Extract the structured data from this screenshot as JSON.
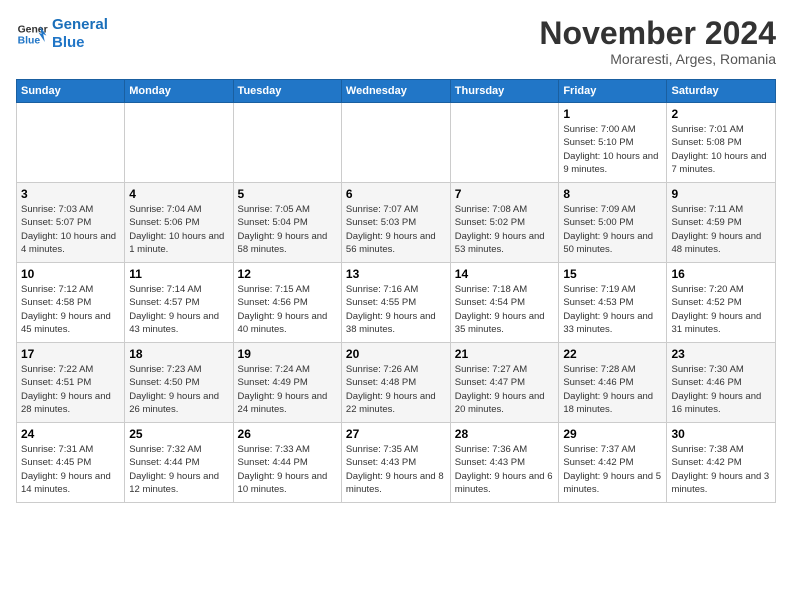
{
  "header": {
    "logo_line1": "General",
    "logo_line2": "Blue",
    "month_title": "November 2024",
    "subtitle": "Moraresti, Arges, Romania"
  },
  "days_of_week": [
    "Sunday",
    "Monday",
    "Tuesday",
    "Wednesday",
    "Thursday",
    "Friday",
    "Saturday"
  ],
  "weeks": [
    [
      {
        "day": "",
        "info": ""
      },
      {
        "day": "",
        "info": ""
      },
      {
        "day": "",
        "info": ""
      },
      {
        "day": "",
        "info": ""
      },
      {
        "day": "",
        "info": ""
      },
      {
        "day": "1",
        "info": "Sunrise: 7:00 AM\nSunset: 5:10 PM\nDaylight: 10 hours\nand 9 minutes."
      },
      {
        "day": "2",
        "info": "Sunrise: 7:01 AM\nSunset: 5:08 PM\nDaylight: 10 hours\nand 7 minutes."
      }
    ],
    [
      {
        "day": "3",
        "info": "Sunrise: 7:03 AM\nSunset: 5:07 PM\nDaylight: 10 hours\nand 4 minutes."
      },
      {
        "day": "4",
        "info": "Sunrise: 7:04 AM\nSunset: 5:06 PM\nDaylight: 10 hours\nand 1 minute."
      },
      {
        "day": "5",
        "info": "Sunrise: 7:05 AM\nSunset: 5:04 PM\nDaylight: 9 hours\nand 58 minutes."
      },
      {
        "day": "6",
        "info": "Sunrise: 7:07 AM\nSunset: 5:03 PM\nDaylight: 9 hours\nand 56 minutes."
      },
      {
        "day": "7",
        "info": "Sunrise: 7:08 AM\nSunset: 5:02 PM\nDaylight: 9 hours\nand 53 minutes."
      },
      {
        "day": "8",
        "info": "Sunrise: 7:09 AM\nSunset: 5:00 PM\nDaylight: 9 hours\nand 50 minutes."
      },
      {
        "day": "9",
        "info": "Sunrise: 7:11 AM\nSunset: 4:59 PM\nDaylight: 9 hours\nand 48 minutes."
      }
    ],
    [
      {
        "day": "10",
        "info": "Sunrise: 7:12 AM\nSunset: 4:58 PM\nDaylight: 9 hours\nand 45 minutes."
      },
      {
        "day": "11",
        "info": "Sunrise: 7:14 AM\nSunset: 4:57 PM\nDaylight: 9 hours\nand 43 minutes."
      },
      {
        "day": "12",
        "info": "Sunrise: 7:15 AM\nSunset: 4:56 PM\nDaylight: 9 hours\nand 40 minutes."
      },
      {
        "day": "13",
        "info": "Sunrise: 7:16 AM\nSunset: 4:55 PM\nDaylight: 9 hours\nand 38 minutes."
      },
      {
        "day": "14",
        "info": "Sunrise: 7:18 AM\nSunset: 4:54 PM\nDaylight: 9 hours\nand 35 minutes."
      },
      {
        "day": "15",
        "info": "Sunrise: 7:19 AM\nSunset: 4:53 PM\nDaylight: 9 hours\nand 33 minutes."
      },
      {
        "day": "16",
        "info": "Sunrise: 7:20 AM\nSunset: 4:52 PM\nDaylight: 9 hours\nand 31 minutes."
      }
    ],
    [
      {
        "day": "17",
        "info": "Sunrise: 7:22 AM\nSunset: 4:51 PM\nDaylight: 9 hours\nand 28 minutes."
      },
      {
        "day": "18",
        "info": "Sunrise: 7:23 AM\nSunset: 4:50 PM\nDaylight: 9 hours\nand 26 minutes."
      },
      {
        "day": "19",
        "info": "Sunrise: 7:24 AM\nSunset: 4:49 PM\nDaylight: 9 hours\nand 24 minutes."
      },
      {
        "day": "20",
        "info": "Sunrise: 7:26 AM\nSunset: 4:48 PM\nDaylight: 9 hours\nand 22 minutes."
      },
      {
        "day": "21",
        "info": "Sunrise: 7:27 AM\nSunset: 4:47 PM\nDaylight: 9 hours\nand 20 minutes."
      },
      {
        "day": "22",
        "info": "Sunrise: 7:28 AM\nSunset: 4:46 PM\nDaylight: 9 hours\nand 18 minutes."
      },
      {
        "day": "23",
        "info": "Sunrise: 7:30 AM\nSunset: 4:46 PM\nDaylight: 9 hours\nand 16 minutes."
      }
    ],
    [
      {
        "day": "24",
        "info": "Sunrise: 7:31 AM\nSunset: 4:45 PM\nDaylight: 9 hours\nand 14 minutes."
      },
      {
        "day": "25",
        "info": "Sunrise: 7:32 AM\nSunset: 4:44 PM\nDaylight: 9 hours\nand 12 minutes."
      },
      {
        "day": "26",
        "info": "Sunrise: 7:33 AM\nSunset: 4:44 PM\nDaylight: 9 hours\nand 10 minutes."
      },
      {
        "day": "27",
        "info": "Sunrise: 7:35 AM\nSunset: 4:43 PM\nDaylight: 9 hours\nand 8 minutes."
      },
      {
        "day": "28",
        "info": "Sunrise: 7:36 AM\nSunset: 4:43 PM\nDaylight: 9 hours\nand 6 minutes."
      },
      {
        "day": "29",
        "info": "Sunrise: 7:37 AM\nSunset: 4:42 PM\nDaylight: 9 hours\nand 5 minutes."
      },
      {
        "day": "30",
        "info": "Sunrise: 7:38 AM\nSunset: 4:42 PM\nDaylight: 9 hours\nand 3 minutes."
      }
    ]
  ]
}
